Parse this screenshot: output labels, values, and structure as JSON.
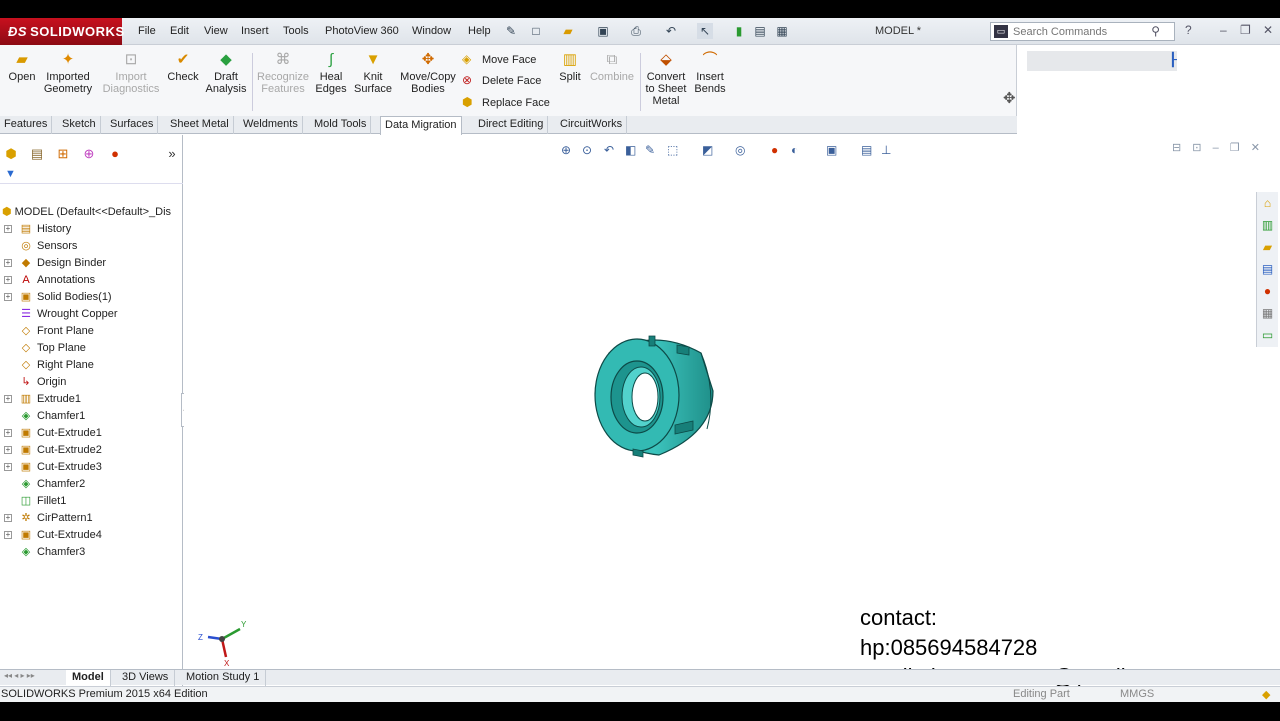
{
  "app": {
    "brand": "SOLIDWORKS",
    "doc_title": "MODEL *"
  },
  "menu": [
    "File",
    "Edit",
    "View",
    "Insert",
    "Tools",
    "PhotoView 360",
    "Window",
    "Help"
  ],
  "search": {
    "placeholder": "Search Commands"
  },
  "ribbon": {
    "open": "Open",
    "imported_geometry": [
      "Imported",
      "Geometry"
    ],
    "import_diagnostics": [
      "Import",
      "Diagnostics"
    ],
    "check": "Check",
    "draft_analysis": [
      "Draft",
      "Analysis"
    ],
    "recognize_features": [
      "Recognize",
      "Features"
    ],
    "heal_edges": [
      "Heal",
      "Edges"
    ],
    "knit_surface": [
      "Knit",
      "Surface"
    ],
    "move_copy_bodies": [
      "Move/Copy",
      "Bodies"
    ],
    "move_face": "Move Face",
    "delete_face": "Delete Face",
    "replace_face": "Replace Face",
    "split": "Split",
    "combine": "Combine",
    "convert_sheet_metal": [
      "Convert",
      "to Sheet",
      "Metal"
    ],
    "insert_bends": [
      "Insert",
      "Bends"
    ]
  },
  "tabs": [
    "Features",
    "Sketch",
    "Surfaces",
    "Sheet Metal",
    "Weldments",
    "Mold Tools",
    "Data Migration",
    "Direct Editing",
    "CircuitWorks"
  ],
  "active_tab": "Data Migration",
  "tree": {
    "root": "MODEL  (Default<<Default>_Dis",
    "items": [
      {
        "label": "History",
        "icon": "history-folder-icon",
        "expand": true
      },
      {
        "label": "Sensors",
        "icon": "sensors-icon",
        "expand": false
      },
      {
        "label": "Design Binder",
        "icon": "design-binder-icon",
        "expand": true
      },
      {
        "label": "Annotations",
        "icon": "annotations-icon",
        "expand": true
      },
      {
        "label": "Solid Bodies(1)",
        "icon": "solid-bodies-icon",
        "expand": true
      },
      {
        "label": "Wrought Copper",
        "icon": "material-icon",
        "expand": false
      },
      {
        "label": "Front Plane",
        "icon": "plane-icon",
        "expand": false
      },
      {
        "label": "Top Plane",
        "icon": "plane-icon",
        "expand": false
      },
      {
        "label": "Right Plane",
        "icon": "plane-icon",
        "expand": false
      },
      {
        "label": "Origin",
        "icon": "origin-icon",
        "expand": false
      },
      {
        "label": "Extrude1",
        "icon": "extrude-icon",
        "expand": true
      },
      {
        "label": "Chamfer1",
        "icon": "chamfer-icon",
        "expand": false
      },
      {
        "label": "Cut-Extrude1",
        "icon": "cut-extrude-icon",
        "expand": true
      },
      {
        "label": "Cut-Extrude2",
        "icon": "cut-extrude-icon",
        "expand": true
      },
      {
        "label": "Cut-Extrude3",
        "icon": "cut-extrude-icon",
        "expand": true
      },
      {
        "label": "Chamfer2",
        "icon": "chamfer-icon",
        "expand": false
      },
      {
        "label": "Fillet1",
        "icon": "fillet-icon",
        "expand": false
      },
      {
        "label": "CirPattern1",
        "icon": "circular-pattern-icon",
        "expand": true
      },
      {
        "label": "Cut-Extrude4",
        "icon": "cut-extrude-icon",
        "expand": true
      },
      {
        "label": "Chamfer3",
        "icon": "chamfer-icon",
        "expand": false
      }
    ]
  },
  "contact": {
    "heading": "contact:",
    "phone": "hp:085694584728",
    "email": "email:abassumarna@ymail.com",
    "url": "https://tutorialcadcam.wordpress.com"
  },
  "bottom_tabs": [
    "Model",
    "3D Views",
    "Motion Study 1"
  ],
  "status": {
    "edition": "SOLIDWORKS Premium 2015 x64 Edition",
    "mode": "Editing Part",
    "units": "MMGS"
  },
  "colors": {
    "model": "#2fb3ac",
    "brand_red": "#c8101e"
  }
}
